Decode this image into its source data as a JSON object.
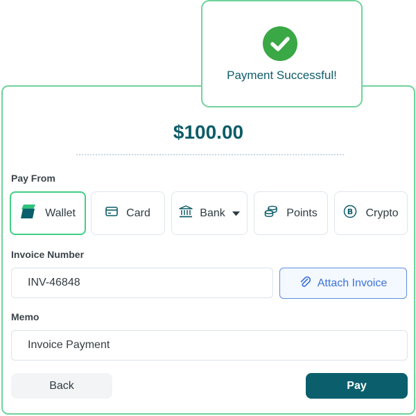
{
  "payment": {
    "amount": "$100.00",
    "pay_from_label": "Pay From",
    "options": [
      {
        "label": "Wallet",
        "icon": "wallet-icon",
        "selected": true
      },
      {
        "label": "Card",
        "icon": "card-icon",
        "selected": false
      },
      {
        "label": "Bank",
        "icon": "bank-icon",
        "selected": false,
        "has_dropdown": true
      },
      {
        "label": "Points",
        "icon": "coins-icon",
        "selected": false
      },
      {
        "label": "Crypto",
        "icon": "bitcoin-icon",
        "selected": false
      }
    ],
    "invoice_label": "Invoice Number",
    "invoice_value": "INV-46848",
    "attach_label": "Attach Invoice",
    "memo_label": "Memo",
    "memo_value": "Invoice Payment",
    "back_label": "Back",
    "pay_label": "Pay"
  },
  "toast": {
    "message": "Payment Successful!",
    "icon": "check-circle-icon"
  },
  "colors": {
    "accent": "#0b5f6c",
    "success": "#3aa845",
    "border_success": "#6fd29a",
    "link_blue": "#3b73d6"
  }
}
